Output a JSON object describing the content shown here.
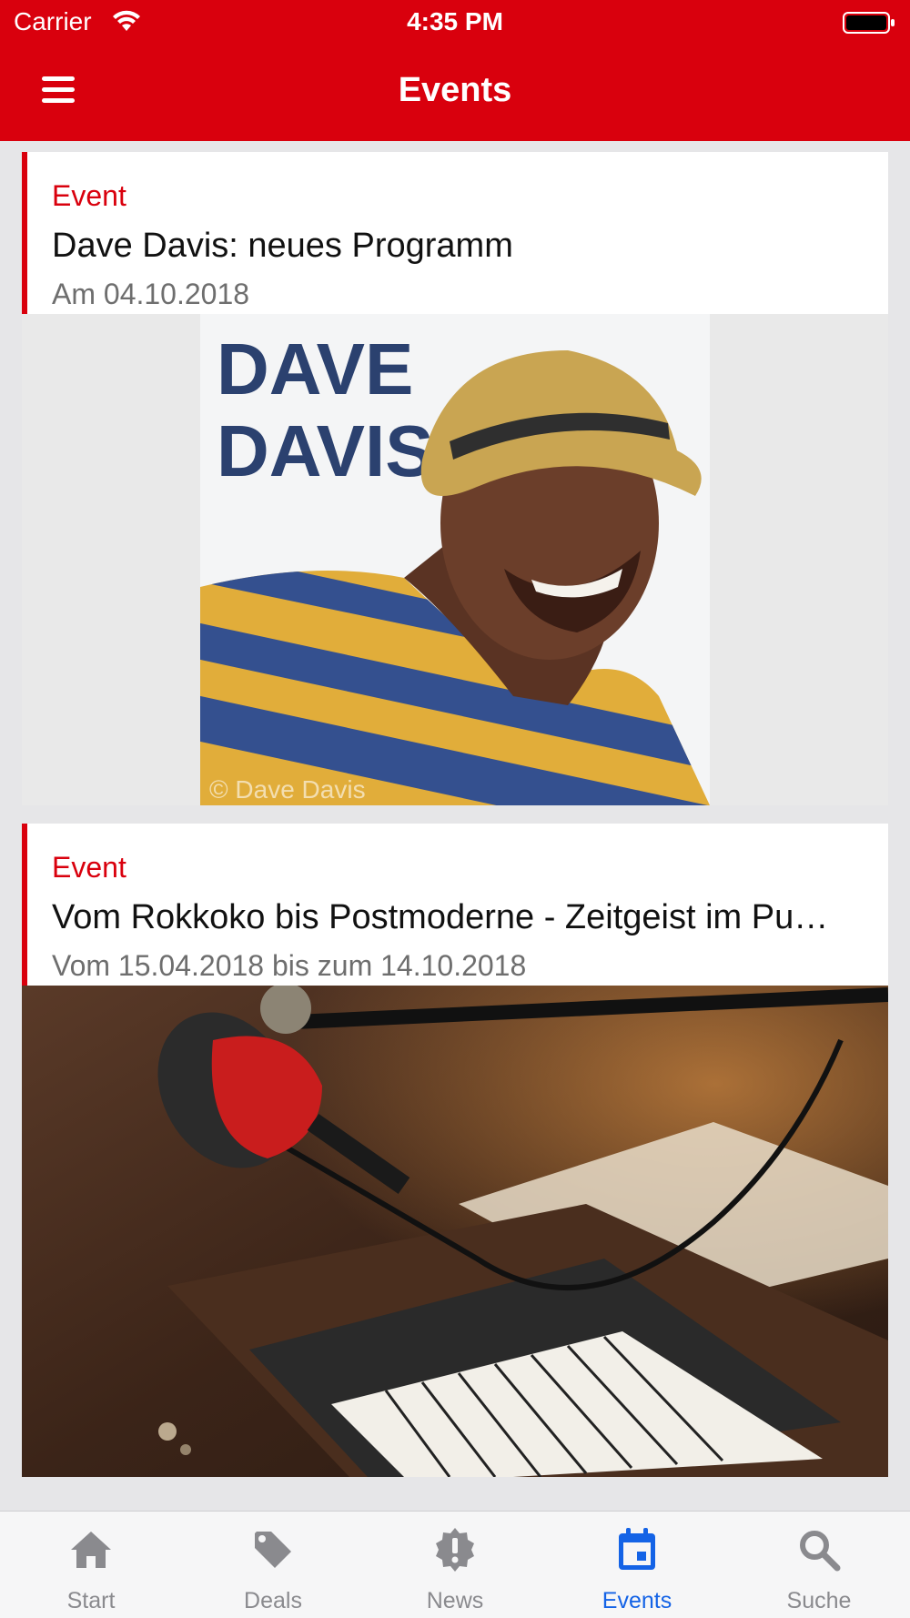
{
  "status_bar": {
    "carrier": "Carrier",
    "time": "4:35 PM"
  },
  "nav": {
    "title": "Events"
  },
  "events": [
    {
      "kicker": "Event",
      "title": "Dave Davis: neues Programm",
      "date": "Am 04.10.2018",
      "image_text": [
        "DAVE",
        "DAVIS"
      ],
      "image_credit": "© Dave Davis"
    },
    {
      "kicker": "Event",
      "title": "Vom Rokkoko bis Postmoderne - Zeitgeist im Pu…",
      "date": "Vom 15.04.2018 bis zum 14.10.2018"
    }
  ],
  "tabs": [
    {
      "label": "Start",
      "icon": "home-icon"
    },
    {
      "label": "Deals",
      "icon": "tag-icon"
    },
    {
      "label": "News",
      "icon": "alert-badge-icon"
    },
    {
      "label": "Events",
      "icon": "calendar-icon",
      "active": true
    },
    {
      "label": "Suche",
      "icon": "search-icon"
    }
  ],
  "colors": {
    "brand_red": "#d9000d",
    "active_tab": "#1463e6",
    "inactive_tab": "#8a8a8e"
  }
}
